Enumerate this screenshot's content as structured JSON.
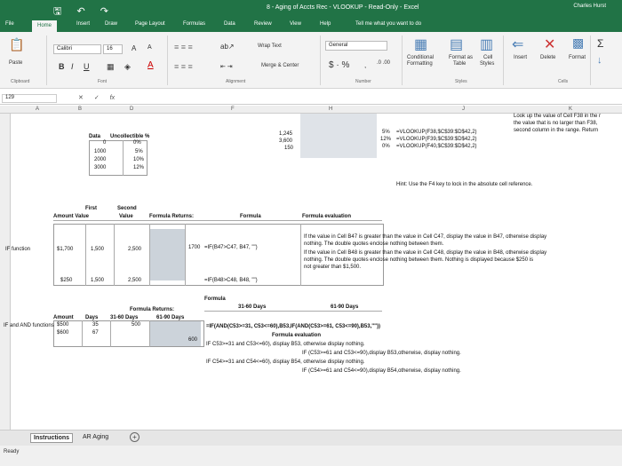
{
  "window": {
    "title": "8 - Aging of Accts Rec - VLOOKUP - Read-Only - Excel",
    "user": "Charles Hurst"
  },
  "qat": {
    "save_glyph": "🖫",
    "undo_glyph": "↶",
    "redo_glyph": "↷"
  },
  "tabs": [
    "File",
    "Home",
    "Insert",
    "Draw",
    "Page Layout",
    "Formulas",
    "Data",
    "Review",
    "View",
    "Help"
  ],
  "tellme": "Tell me what you want to do",
  "ribbon": {
    "font_name": "Calibri",
    "font_size": "16",
    "wrap_text": "Wrap Text",
    "merge_center": "Merge & Center",
    "number_format": "General",
    "cond_format_1": "Conditional",
    "cond_format_2": "Formatting",
    "format_as_table_1": "Format as",
    "format_as_table_2": "Table",
    "cell_styles_1": "Cell",
    "cell_styles_2": "Styles",
    "insert": "Insert",
    "delete": "Delete",
    "format": "Format",
    "groups": {
      "clipboard": "Clipboard",
      "font": "Font",
      "alignment": "Alignment",
      "number": "Number",
      "styles": "Styles",
      "cells": "Cells"
    },
    "paste": "Paste",
    "bold": "B",
    "italic": "I",
    "underline": "U"
  },
  "formula_bar": {
    "name_box": "129",
    "cancel": "✕",
    "enter": "✓",
    "fx": "fx"
  },
  "columns": [
    "A",
    "B",
    "C",
    "D",
    "E",
    "F",
    "G",
    "H",
    "I",
    "J",
    "K"
  ],
  "sheet": {
    "data_header": "Data",
    "uncollectible_header": "Uncollectible %",
    "uncoll_zero": "0",
    "uncoll_zero_pct": "0%",
    "uncoll_rows": [
      [
        "1000",
        "5%"
      ],
      [
        "2000",
        "10%"
      ],
      [
        "3000",
        "12%"
      ]
    ],
    "lookup_values": [
      "1,245",
      "3,600",
      "150"
    ],
    "vlookup_results": [
      [
        "5%",
        "=VLOOKUP(F38,$C$39:$D$42,2)"
      ],
      [
        "12%",
        "=VLOOKUP(F39,$C$39:$D$42,2)"
      ],
      [
        "0%",
        "=VLOOKUP(F40,$C$39:$D$42,2)"
      ]
    ],
    "side_note": [
      "Look up the value of Cell F38 in the r",
      "the value that is no larger than F38,",
      "second column in the range. Return"
    ],
    "hint": "Hint:  Use the F4 key to lock in the absolute cell reference.",
    "if_headers": {
      "first_amount_1": "First",
      "first_amount_2": "Amount  Value",
      "second_value_1": "Second",
      "second_value_2": "Value",
      "formula_returns": "Formula Returns:",
      "formula": "Formula",
      "formula_eval": "Formula evaluation"
    },
    "if_label": "IF function",
    "if_row1": {
      "amount": "$1,700",
      "first": "1,500",
      "second": "2,500",
      "result": "1700",
      "formula": "=IF(B47>C47, B47, \"\")"
    },
    "if_row2": {
      "amount": "$250",
      "first": "1,500",
      "second": "2,500",
      "formula": "=IF(B48>C48, B48, \"\")"
    },
    "if_eval": [
      "If the value in Cell B47 is greater than the value in Cell C47, display the value in B47, otherwise display",
      "nothing.  The double quotes enclose nothing between them.",
      "If the value in Cell B48 is greater than the value in Cell C48, display the value in B48, otherwise display",
      "nothing.  The double quotes enclose nothing between them.  Nothing is displayed because $250 is",
      "not greater than $1,500."
    ],
    "and_headers": {
      "formula": "Formula",
      "d31_60": "31-60 Days",
      "d61_90": "61-90 Days",
      "formula_returns": "Formula Returns:",
      "r31_60": "31-60 Days",
      "r61_90": "61-90 Days",
      "amount": "Amount",
      "days": "Days"
    },
    "and_label": "IF and AND functions",
    "and_rows": [
      [
        "$500",
        "35",
        "500",
        ""
      ],
      [
        "$600",
        "67",
        "",
        "600"
      ]
    ],
    "and_formula": "=IF(AND(C53>=31, C53<=60),B53,IF(AND(C53>=61, C53<=90),B53,\"\"))",
    "and_eval_title": "Formula evaluation",
    "and_eval": [
      "IF C53>=31 and C53<=60), display B53, otherwise display nothing.",
      "IF (C53>=61 and C53<=90),display B53,otherwise, display nothing.",
      "IF C54>=31 and C54<=60), display B54, otherwise display nothing.",
      "IF (C54>=61 and C54<=90),display B54,otherwise, display nothing."
    ]
  },
  "sheet_tabs": [
    "Instructions",
    "AR Aging"
  ],
  "status": "Ready"
}
